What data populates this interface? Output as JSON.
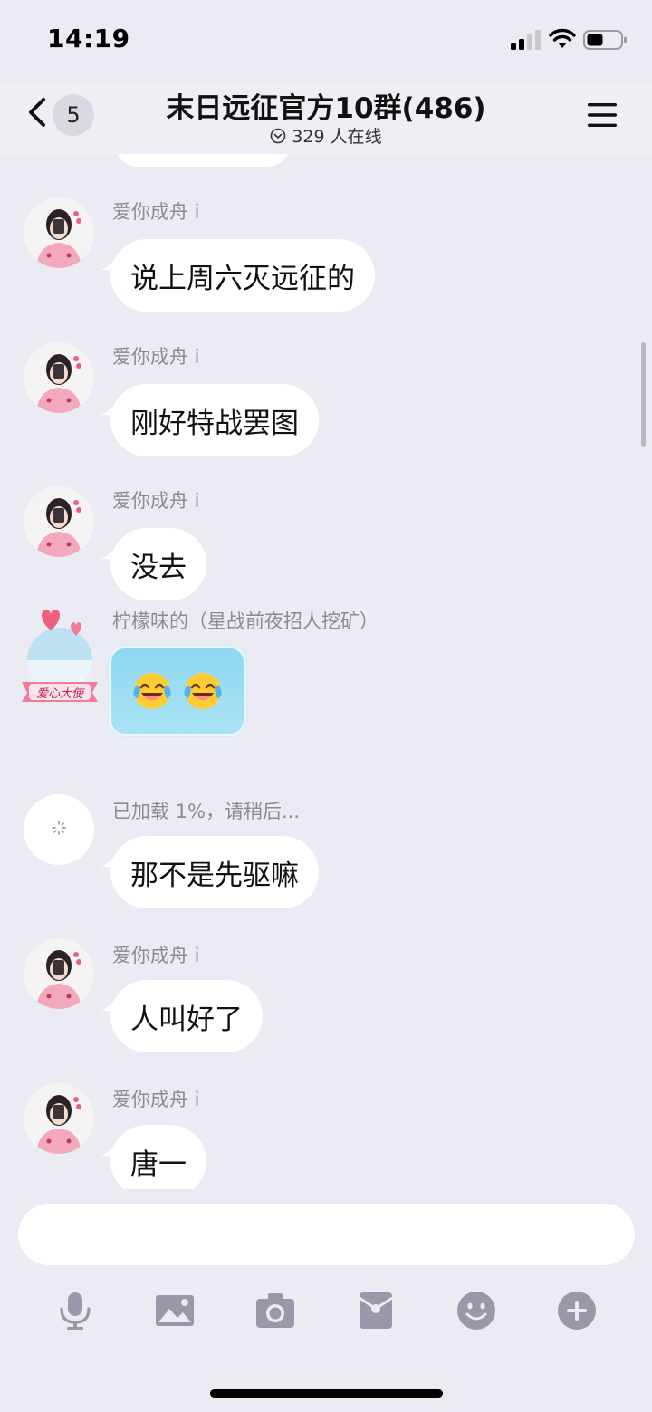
{
  "status_bar": {
    "time": "14:19"
  },
  "nav": {
    "unread_count": "5",
    "title": "末日远征官方10群(486)",
    "online_text": "329 人在线"
  },
  "messages": [
    {
      "sender": "爱你成舟 i",
      "text": "说上周六灭远征的"
    },
    {
      "sender": "爱你成舟 i",
      "text": "刚好特战罢图"
    },
    {
      "sender": "爱你成舟 i",
      "text": "没去"
    },
    {
      "sender": "柠檬味的（星战前夜招人挖矿）",
      "emoji_icons": [
        "tears-of-joy-emoji",
        "tears-of-joy-emoji"
      ]
    },
    {
      "sender": "已加载 1%，请稍后...",
      "text": "那不是先驱嘛"
    },
    {
      "sender": "爱你成舟 i",
      "text": "人叫好了"
    },
    {
      "sender": "爱你成舟 i",
      "text": "唐一"
    }
  ],
  "avatar_badge_text": "爱心大使",
  "input": {
    "value": "",
    "placeholder": ""
  },
  "toolbar": [
    "microphone-icon",
    "image-icon",
    "camera-icon",
    "red-packet-icon",
    "emoji-icon",
    "plus-icon"
  ],
  "colors": {
    "background": "#ebebf3",
    "bubble": "#ffffff",
    "icon": "#9898a8",
    "sender_text": "#8a8a93"
  }
}
